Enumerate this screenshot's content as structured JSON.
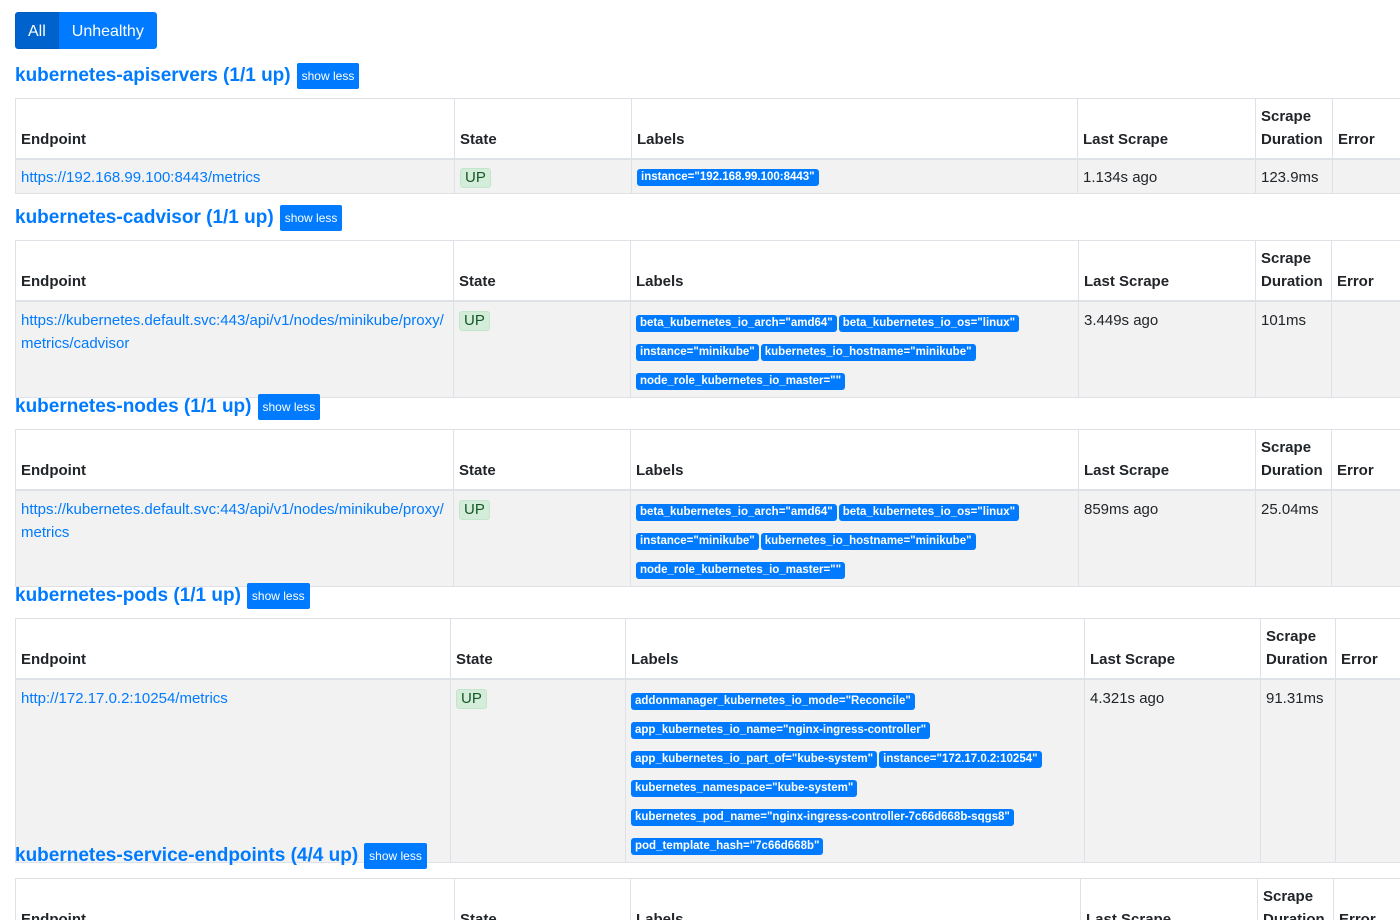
{
  "filters": {
    "all": "All",
    "unhealthy": "Unhealthy"
  },
  "headers": {
    "endpoint": "Endpoint",
    "state": "State",
    "labels": "Labels",
    "last_scrape": "Last Scrape",
    "scrape": "Scrape",
    "duration": "Duration",
    "error": "Error"
  },
  "show_less": "show less",
  "jobs": [
    {
      "title": "kubernetes-apiservers (1/1 up)",
      "endpoint": "https://192.168.99.100:8443/metrics",
      "state": "UP",
      "labels": [
        "instance=\"192.168.99.100:8443\""
      ],
      "last_scrape": "1.134s ago",
      "duration": "123.9ms",
      "error": ""
    },
    {
      "title": "kubernetes-cadvisor (1/1 up)",
      "endpoint": "https://kubernetes.default.svc:443/api/v1/nodes/minikube/proxy/metrics/cadvisor",
      "state": "UP",
      "labels": [
        "beta_kubernetes_io_arch=\"amd64\"",
        "beta_kubernetes_io_os=\"linux\"",
        "instance=\"minikube\"",
        "kubernetes_io_hostname=\"minikube\"",
        "node_role_kubernetes_io_master=\"\""
      ],
      "last_scrape": "3.449s ago",
      "duration": "101ms",
      "error": ""
    },
    {
      "title": "kubernetes-nodes (1/1 up)",
      "endpoint": "https://kubernetes.default.svc:443/api/v1/nodes/minikube/proxy/metrics",
      "state": "UP",
      "labels": [
        "beta_kubernetes_io_arch=\"amd64\"",
        "beta_kubernetes_io_os=\"linux\"",
        "instance=\"minikube\"",
        "kubernetes_io_hostname=\"minikube\"",
        "node_role_kubernetes_io_master=\"\""
      ],
      "last_scrape": "859ms ago",
      "duration": "25.04ms",
      "error": ""
    },
    {
      "title": "kubernetes-pods (1/1 up)",
      "endpoint": "http://172.17.0.2:10254/metrics",
      "state": "UP",
      "labels": [
        "addonmanager_kubernetes_io_mode=\"Reconcile\"",
        "app_kubernetes_io_name=\"nginx-ingress-controller\"",
        "app_kubernetes_io_part_of=\"kube-system\"",
        "instance=\"172.17.0.2:10254\"",
        "kubernetes_namespace=\"kube-system\"",
        "kubernetes_pod_name=\"nginx-ingress-controller-7c66d668b-sqgs8\"",
        "pod_template_hash=\"7c66d668b\""
      ],
      "last_scrape": "4.321s ago",
      "duration": "91.31ms",
      "error": ""
    },
    {
      "title": "kubernetes-service-endpoints (4/4 up)"
    }
  ]
}
